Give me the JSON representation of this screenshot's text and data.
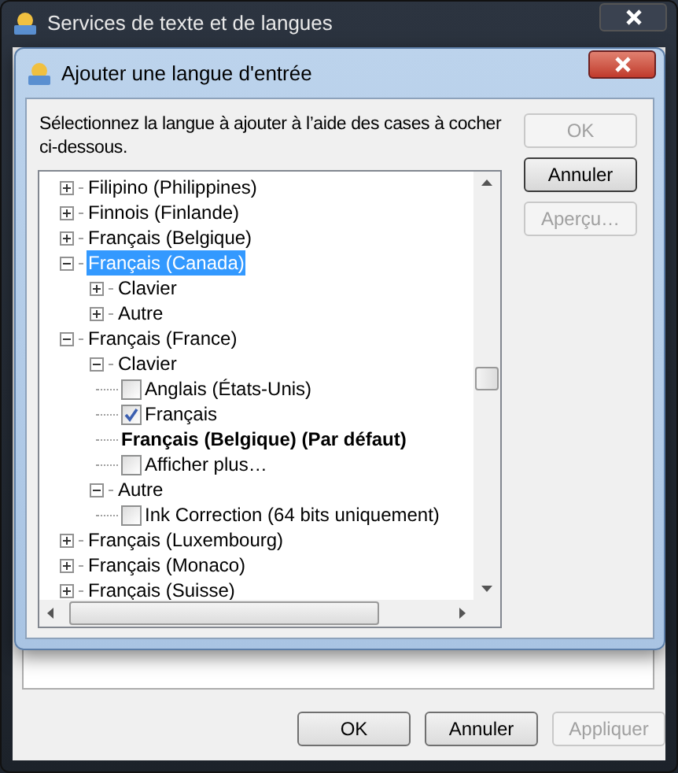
{
  "window": {
    "title": "Services de texte et de langues",
    "buttons": [
      {
        "label": "OK",
        "disabled": false
      },
      {
        "label": "Annuler",
        "disabled": false
      },
      {
        "label": "Appliquer",
        "disabled": true
      }
    ]
  },
  "dialog": {
    "title": "Ajouter une langue d'entrée",
    "instruction": "Sélectionnez la langue à ajouter à l’aide des cases à cocher ci-dessous.",
    "buttons": [
      {
        "label": "OK",
        "disabled": true,
        "focused": false
      },
      {
        "label": "Annuler",
        "disabled": false,
        "focused": true
      },
      {
        "label": "Aperçu…",
        "disabled": true,
        "focused": false
      }
    ],
    "tree": {
      "items": [
        {
          "kind": "node",
          "label": "Filipino (Philippines)",
          "expanded": false,
          "selected": false
        },
        {
          "kind": "node",
          "label": "Finnois (Finlande)",
          "expanded": false,
          "selected": false
        },
        {
          "kind": "node",
          "label": "Français (Belgique)",
          "expanded": false,
          "selected": false
        },
        {
          "kind": "node",
          "label": "Français (Canada)",
          "expanded": true,
          "selected": true,
          "children": [
            {
              "kind": "node",
              "label": "Clavier",
              "expanded": false,
              "selected": false
            },
            {
              "kind": "node",
              "label": "Autre",
              "expanded": false,
              "selected": false
            }
          ]
        },
        {
          "kind": "node",
          "label": "Français (France)",
          "expanded": true,
          "selected": false,
          "children": [
            {
              "kind": "node",
              "label": "Clavier",
              "expanded": true,
              "selected": false,
              "children": [
                {
                  "kind": "checkbox",
                  "label": "Anglais (États-Unis)",
                  "checked": false
                },
                {
                  "kind": "checkbox",
                  "label": "Français",
                  "checked": true
                },
                {
                  "kind": "default",
                  "label": "Français (Belgique) (Par défaut)"
                },
                {
                  "kind": "checkbox",
                  "label": "Afficher plus…",
                  "checked": false
                }
              ]
            },
            {
              "kind": "node",
              "label": "Autre",
              "expanded": true,
              "selected": false,
              "children": [
                {
                  "kind": "checkbox",
                  "label": "Ink Correction (64 bits uniquement)",
                  "checked": false
                }
              ]
            }
          ]
        },
        {
          "kind": "node",
          "label": "Français (Luxembourg)",
          "expanded": false,
          "selected": false
        },
        {
          "kind": "node",
          "label": "Français (Monaco)",
          "expanded": false,
          "selected": false
        },
        {
          "kind": "node",
          "label": "Français (Suisse)",
          "expanded": false,
          "selected": false
        }
      ]
    }
  }
}
